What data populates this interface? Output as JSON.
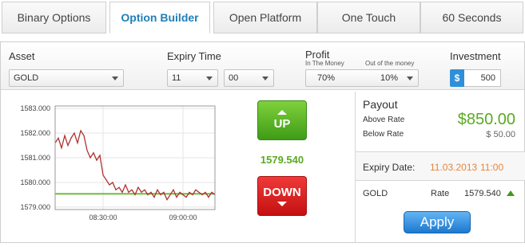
{
  "tabs": [
    {
      "label": "Binary Options",
      "active": false
    },
    {
      "label": "Option Builder",
      "active": true
    },
    {
      "label": "Open Platform",
      "active": false
    },
    {
      "label": "One Touch",
      "active": false
    },
    {
      "label": "60 Seconds",
      "active": false
    }
  ],
  "controls": {
    "asset_label": "Asset",
    "asset_value": "GOLD",
    "expiry_label": "Expiry Time",
    "expiry_hour": "11",
    "expiry_minute": "00",
    "profit_label": "Profit",
    "in_money_label": "In The Money",
    "out_money_label": "Out of the money",
    "in_money_value": "70%",
    "out_money_value": "10%",
    "investment_label": "Investment",
    "currency_symbol": "$",
    "investment_value": "500"
  },
  "chart_data": {
    "type": "line",
    "y_ticks": [
      "1583.000",
      "1582.000",
      "1581.000",
      "1580.000",
      "1579.000"
    ],
    "x_ticks": [
      "08:30:00",
      "09:00:00"
    ],
    "ylim": [
      1578.9,
      1583.1
    ],
    "xlim": [
      0,
      100
    ],
    "strike_rate": 1579.54,
    "series": [
      {
        "color": "#b03030",
        "x": [
          0,
          2,
          4,
          6,
          8,
          10,
          12,
          14,
          16,
          18,
          20,
          22,
          24,
          26,
          28,
          30,
          32,
          34,
          36,
          38,
          40,
          42,
          44,
          46,
          48,
          50,
          52,
          54,
          56,
          58,
          60,
          62,
          64,
          66,
          68,
          70,
          72,
          74,
          76,
          78,
          80,
          82,
          84,
          86,
          88,
          90,
          92,
          94,
          96,
          98,
          100
        ],
        "y": [
          1581.6,
          1581.8,
          1581.4,
          1581.9,
          1581.5,
          1581.8,
          1582.0,
          1581.6,
          1582.1,
          1581.9,
          1581.3,
          1581.0,
          1581.2,
          1580.9,
          1581.1,
          1580.3,
          1580.1,
          1579.9,
          1580.0,
          1579.7,
          1579.8,
          1579.6,
          1579.9,
          1579.6,
          1579.7,
          1579.5,
          1579.8,
          1579.6,
          1579.7,
          1579.5,
          1579.6,
          1579.4,
          1579.7,
          1579.5,
          1579.6,
          1579.3,
          1579.5,
          1579.7,
          1579.4,
          1579.6,
          1579.5,
          1579.4,
          1579.6,
          1579.5,
          1579.7,
          1579.6,
          1579.5,
          1579.6,
          1579.4,
          1579.6,
          1579.5
        ]
      }
    ],
    "strike_color": "#6cbf3a"
  },
  "trade": {
    "up_label": "UP",
    "down_label": "DOWN",
    "current_rate": "1579.540"
  },
  "payout": {
    "title": "Payout",
    "above_label": "Above Rate",
    "below_label": "Below Rate",
    "above_value": "$850.00",
    "below_value": "$ 50.00"
  },
  "expiry": {
    "label": "Expiry Date:",
    "date": "11.03.2013",
    "time": "11:00"
  },
  "asset_row": {
    "name": "GOLD",
    "rate_label": "Rate",
    "rate_value": "1579.540"
  },
  "apply_label": "Apply"
}
